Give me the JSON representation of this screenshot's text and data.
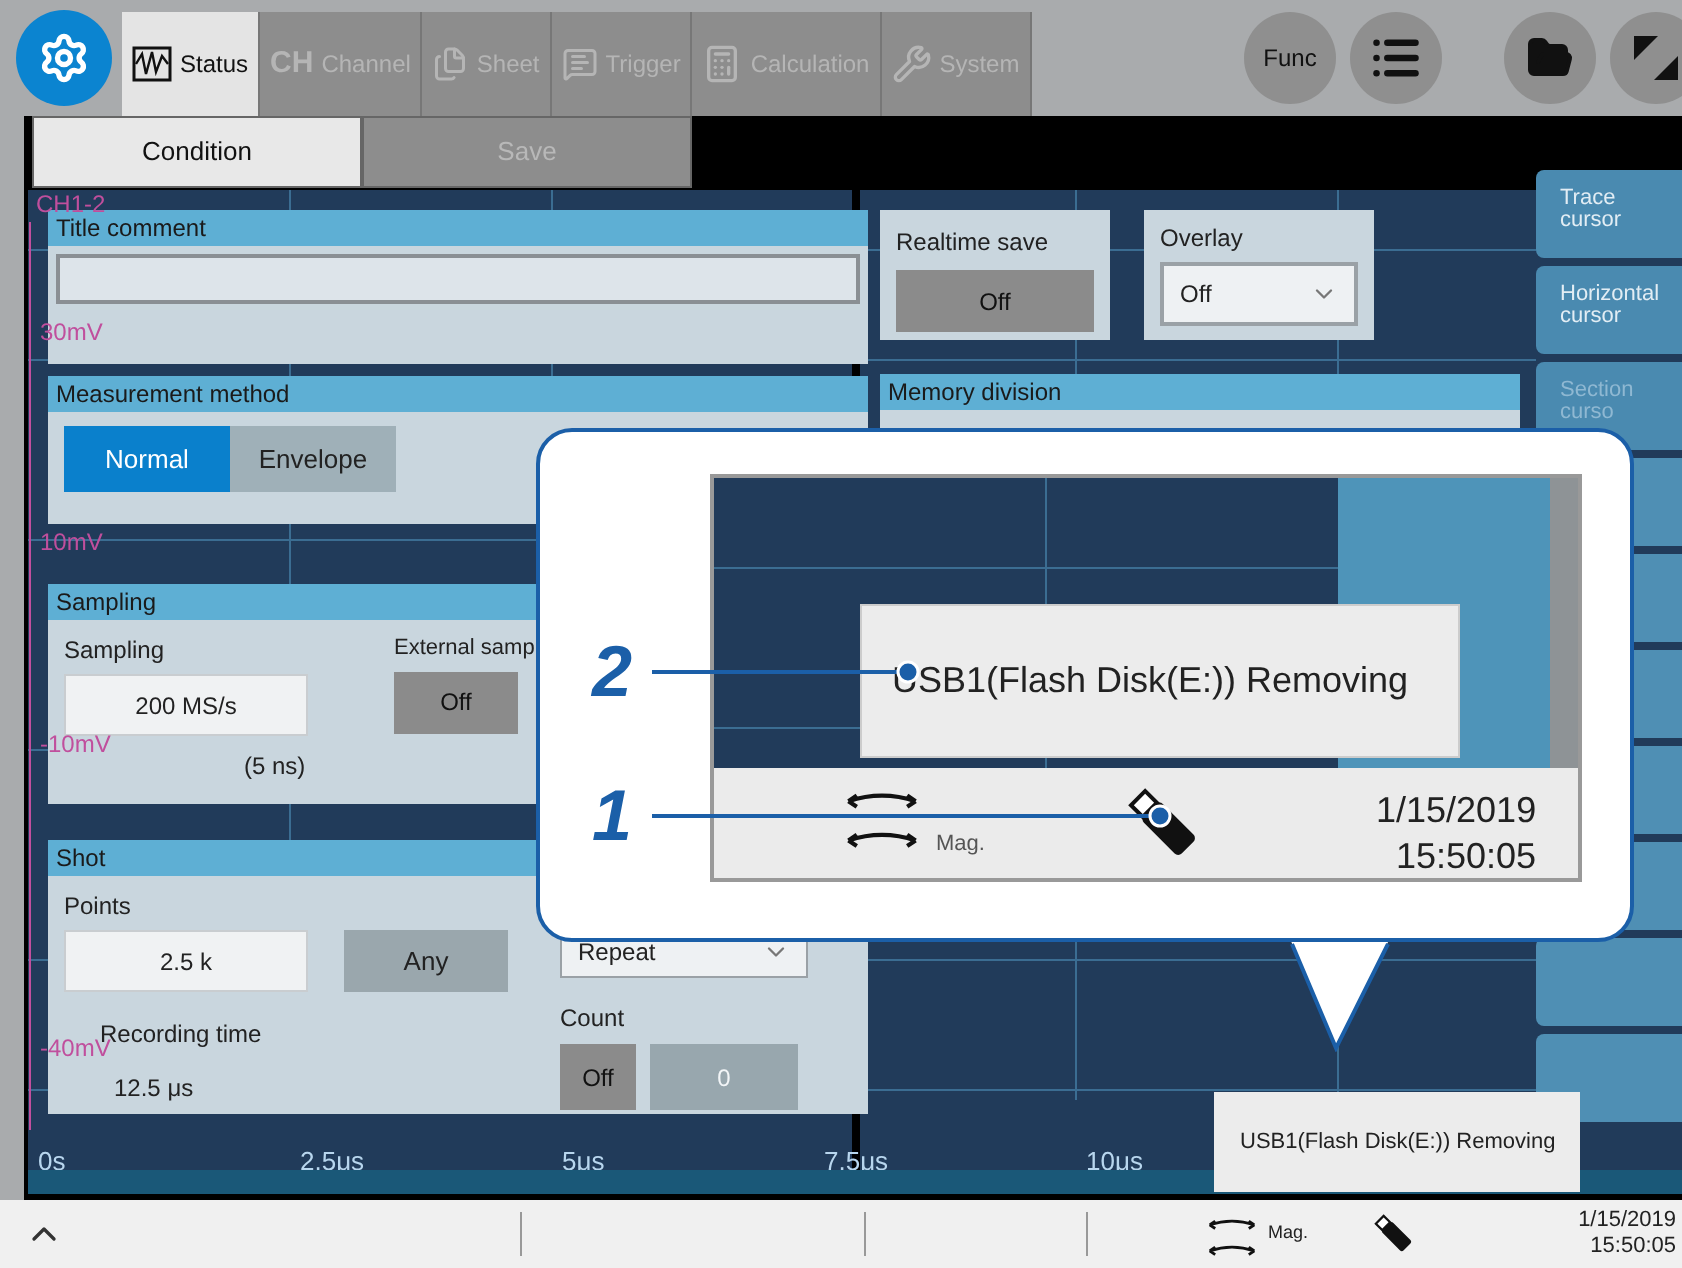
{
  "toolbar": {
    "tabs": [
      {
        "label": "Status",
        "selected": true,
        "disabled": false
      },
      {
        "prefix": "CH",
        "label": "Channel",
        "selected": false,
        "disabled": true
      },
      {
        "label": "Sheet",
        "selected": false,
        "disabled": true
      },
      {
        "label": "Trigger",
        "selected": false,
        "disabled": true
      },
      {
        "label": "Calculation",
        "selected": false,
        "disabled": true
      },
      {
        "label": "System",
        "selected": false,
        "disabled": true
      }
    ],
    "func_button": "Func"
  },
  "subtabs": [
    {
      "label": "Condition",
      "selected": true
    },
    {
      "label": "Save",
      "selected": false
    }
  ],
  "graph": {
    "channel_label": "CH1-2",
    "y_labels": [
      "30mV",
      "10mV",
      "-10mV",
      "-40mV"
    ],
    "x_labels": [
      "0s",
      "2.5μs",
      "5μs",
      "7.5μs",
      "10μs"
    ]
  },
  "title_comment": {
    "title": "Title comment"
  },
  "measurement_method": {
    "title": "Measurement method",
    "options": [
      {
        "label": "Normal",
        "selected": true
      },
      {
        "label": "Envelope",
        "selected": false
      }
    ]
  },
  "sampling": {
    "title": "Sampling",
    "sampling_label": "Sampling",
    "sampling_value": "200 MS/s",
    "period": "(5 ns)",
    "external_label": "External samp",
    "external_value": "Off"
  },
  "shot": {
    "title": "Shot",
    "points_label": "Points",
    "points_value": "2.5 k",
    "any_button": "Any",
    "mode_value": "Repeat",
    "recording_time_label": "Recording time",
    "recording_time_value": "12.5 μs",
    "count_label": "Count",
    "count_toggle": "Off",
    "count_value": "0"
  },
  "realtime_save": {
    "label": "Realtime save",
    "value": "Off"
  },
  "overlay": {
    "label": "Overlay",
    "value": "Off"
  },
  "memory_division": {
    "title": "Memory division"
  },
  "side_menu": [
    {
      "label": "Trace cursor",
      "disabled": false
    },
    {
      "label": "Horizontal cursor",
      "disabled": false
    },
    {
      "label": "Section curso",
      "disabled": true
    }
  ],
  "callout": {
    "markers": [
      "2",
      "1"
    ],
    "popup_message": "USB1(Flash Disk(E:)) Removing",
    "mag_label": "Mag.",
    "date": "1/15/2019",
    "time": "15:50:05"
  },
  "toast": {
    "message": "USB1(Flash Disk(E:)) Removing"
  },
  "status_bar": {
    "mag_label": "Mag.",
    "date": "1/15/2019",
    "time": "15:50:05"
  }
}
